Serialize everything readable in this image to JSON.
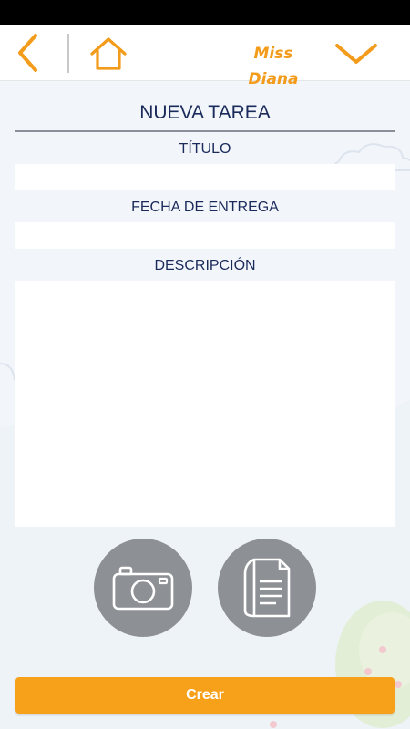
{
  "header": {
    "user_name": "Miss Diana"
  },
  "form": {
    "title": "NUEVA TAREA",
    "labels": {
      "titulo": "TÍTULO",
      "fecha": "FECHA DE ENTREGA",
      "descripcion": "DESCRIPCIÓN"
    },
    "values": {
      "titulo": "",
      "fecha": "",
      "descripcion": ""
    },
    "submit_label": "Crear"
  },
  "icons": {
    "back": "chevron-left-icon",
    "home": "home-icon",
    "dropdown": "chevron-down-icon",
    "camera": "camera-icon",
    "document": "document-icon"
  },
  "colors": {
    "accent": "#f39b1a",
    "button": "#f7a11a",
    "text": "#1a2a5a",
    "circle": "#8d9196"
  }
}
